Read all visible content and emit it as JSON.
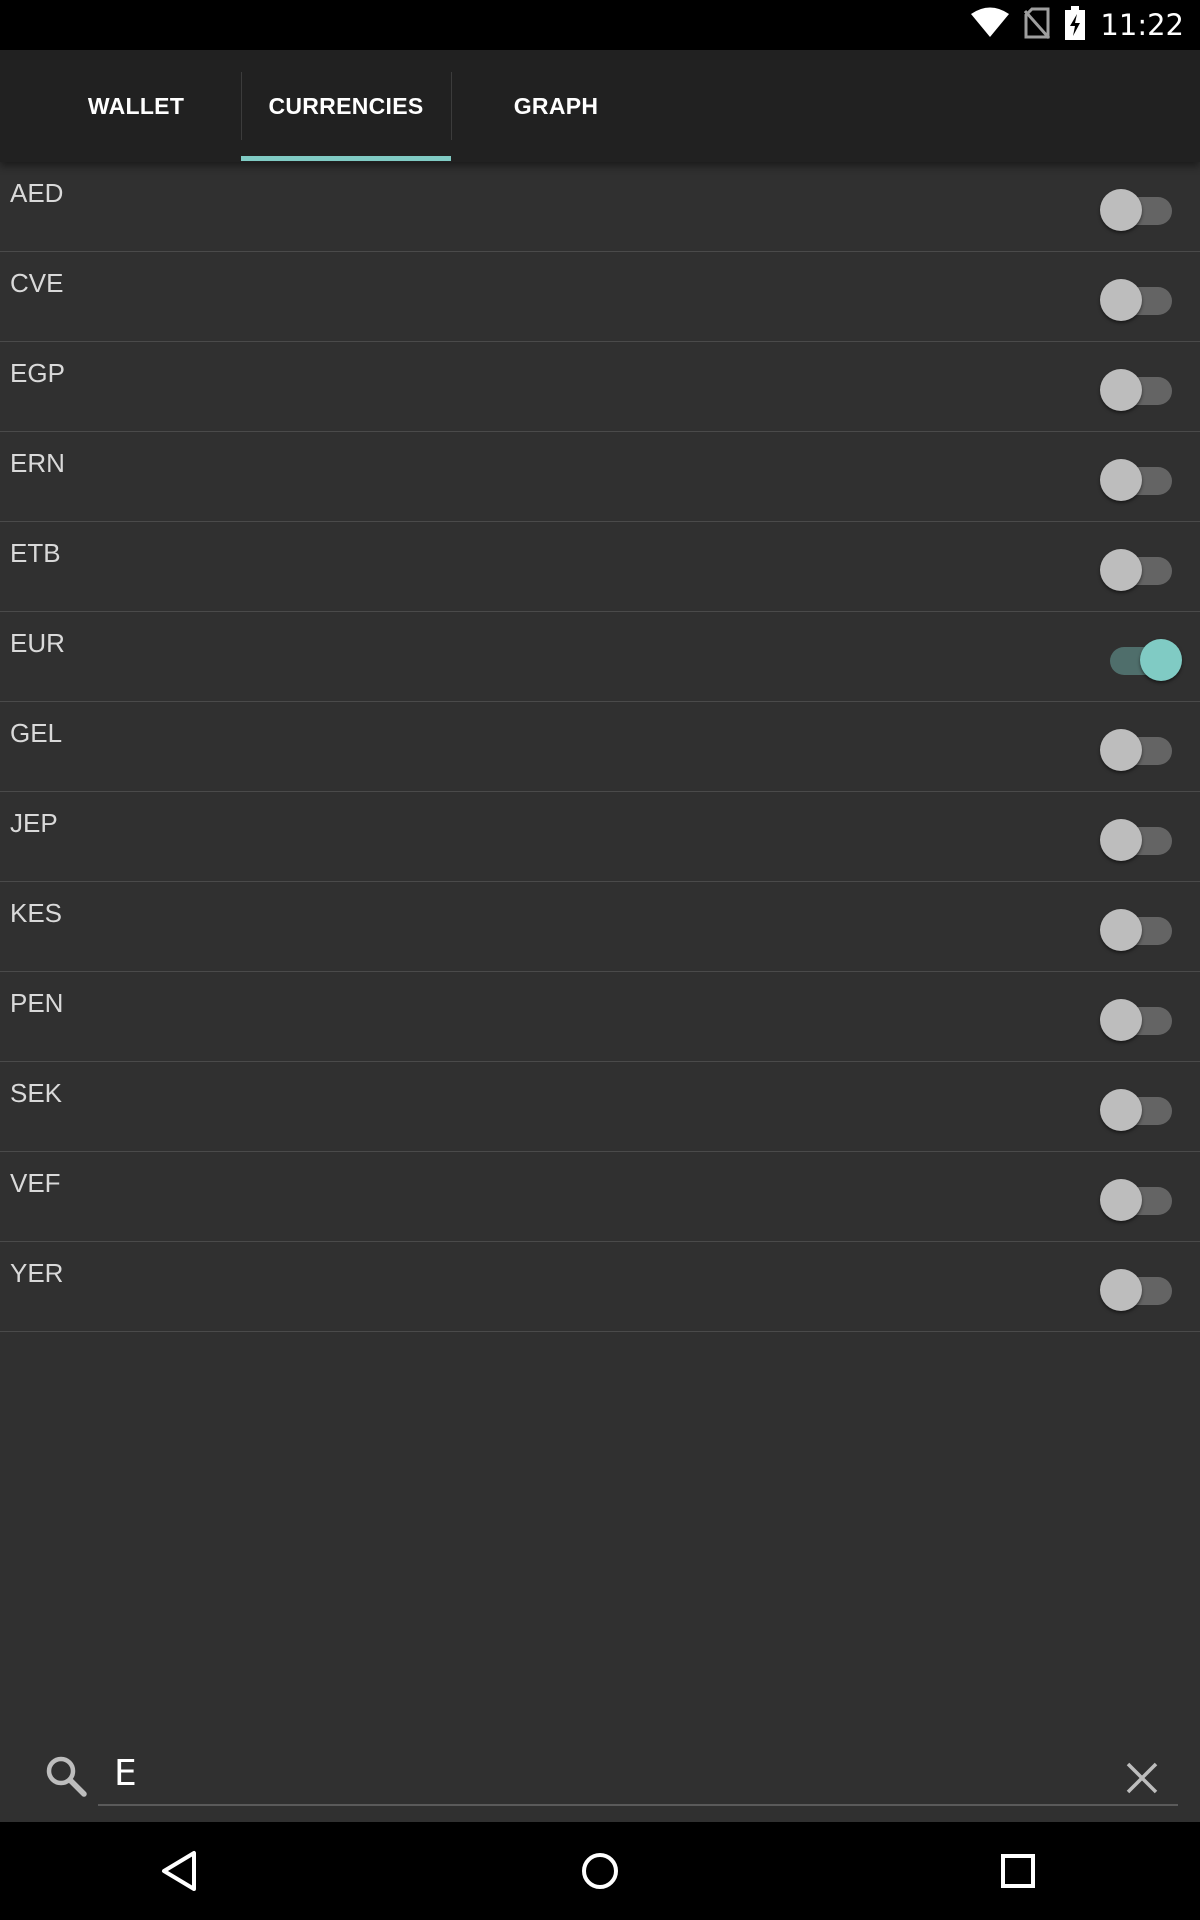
{
  "status_bar": {
    "time": "11:22",
    "icons": [
      "wifi-icon",
      "no-sim-icon",
      "battery-charging-icon"
    ]
  },
  "tabs": [
    {
      "label": "WALLET",
      "selected": false
    },
    {
      "label": "CURRENCIES",
      "selected": true
    },
    {
      "label": "GRAPH",
      "selected": false
    }
  ],
  "accent_color": "#80cbc4",
  "currencies": [
    {
      "code": "AED",
      "enabled": false
    },
    {
      "code": "CVE",
      "enabled": false
    },
    {
      "code": "EGP",
      "enabled": false
    },
    {
      "code": "ERN",
      "enabled": false
    },
    {
      "code": "ETB",
      "enabled": false
    },
    {
      "code": "EUR",
      "enabled": true
    },
    {
      "code": "GEL",
      "enabled": false
    },
    {
      "code": "JEP",
      "enabled": false
    },
    {
      "code": "KES",
      "enabled": false
    },
    {
      "code": "PEN",
      "enabled": false
    },
    {
      "code": "SEK",
      "enabled": false
    },
    {
      "code": "VEF",
      "enabled": false
    },
    {
      "code": "YER",
      "enabled": false
    }
  ],
  "search": {
    "value": "E",
    "icon": "search-icon",
    "clear_icon": "close-icon"
  },
  "nav_bar": {
    "icons": [
      "back-icon",
      "home-icon",
      "recents-icon"
    ]
  }
}
